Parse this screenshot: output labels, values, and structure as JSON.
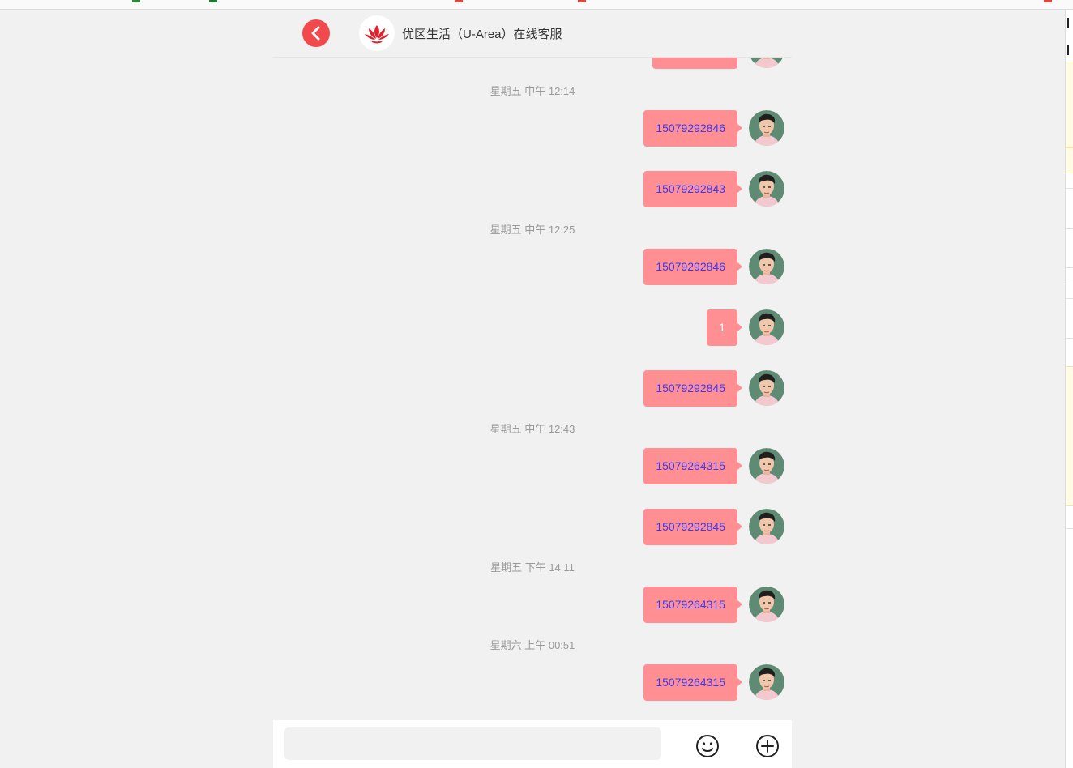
{
  "header": {
    "back_icon": "chevron-left-icon",
    "logo_icon": "lotus-logo-icon",
    "title": "优区生活（U-Area）在线客服"
  },
  "messages": [
    {
      "type": "message",
      "text": ""
    },
    {
      "type": "time",
      "text": "星期五 中午 12:14"
    },
    {
      "type": "message",
      "text": "15079292846"
    },
    {
      "type": "message",
      "text": "15079292843"
    },
    {
      "type": "time",
      "text": "星期五 中午 12:25"
    },
    {
      "type": "message",
      "text": "15079292846"
    },
    {
      "type": "message",
      "text": "1"
    },
    {
      "type": "message",
      "text": "15079292845"
    },
    {
      "type": "time",
      "text": "星期五 中午 12:43"
    },
    {
      "type": "message",
      "text": "15079264315"
    },
    {
      "type": "message",
      "text": "15079292845"
    },
    {
      "type": "time",
      "text": "星期五 下午 14:11"
    },
    {
      "type": "message",
      "text": "15079264315"
    },
    {
      "type": "time",
      "text": "星期六 上午 00:51"
    },
    {
      "type": "message",
      "text": "15079264315"
    }
  ],
  "composer": {
    "placeholder": "",
    "emoji_icon": "smiley-icon",
    "add_icon": "plus-circle-icon"
  },
  "colors": {
    "accent": "#f1494c",
    "bubble": "#ff8f93",
    "link_text": "#3a3af2",
    "background": "#f1f1f1"
  }
}
